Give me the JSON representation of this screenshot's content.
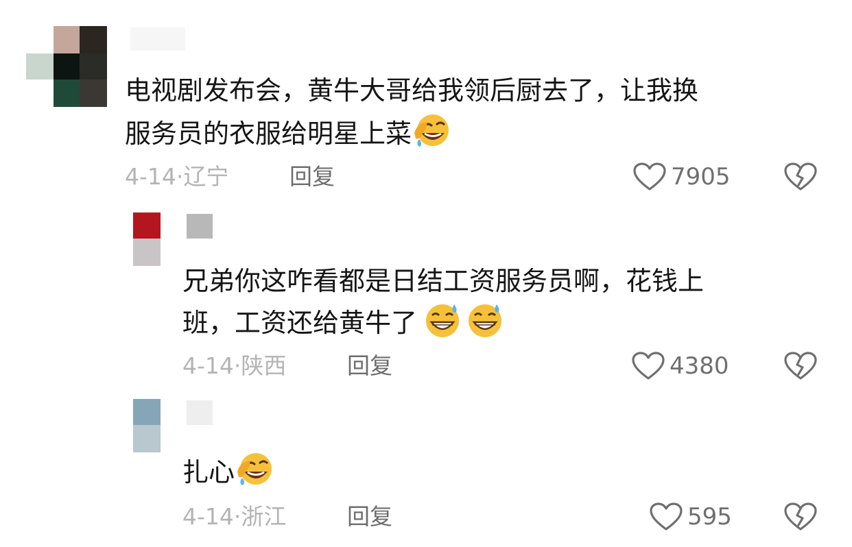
{
  "comments": [
    {
      "text_line1": "电视剧发布会，黄牛大哥给我领后厨去了，让我换",
      "text_line2": "服务员的衣服给明星上菜",
      "emojis": [
        "facepalm-laugh-emoji"
      ],
      "date": "4-14",
      "location": "辽宁",
      "reply_label": "回复",
      "likes": "7905"
    },
    {
      "text_line1": "兄弟你这咋看都是日结工资服务员啊，花钱上",
      "text_line2": "班，工资还给黄牛了",
      "emojis": [
        "grin-sweat-emoji",
        "grin-sweat-emoji"
      ],
      "date": "4-14",
      "location": "陕西",
      "reply_label": "回复",
      "likes": "4380"
    },
    {
      "text_line1": "扎心",
      "emojis": [
        "facepalm-laugh-emoji"
      ],
      "date": "4-14",
      "location": "浙江",
      "reply_label": "回复",
      "likes": "595"
    }
  ],
  "icons": {
    "like": "heart-outline-icon",
    "dislike": "broken-heart-icon"
  },
  "colors": {
    "text": "#151515",
    "meta": "#b4b4b4",
    "reply": "#6d6d6d",
    "icon": "#6f6f6f",
    "emoji_yellow": "#f6c13a"
  }
}
